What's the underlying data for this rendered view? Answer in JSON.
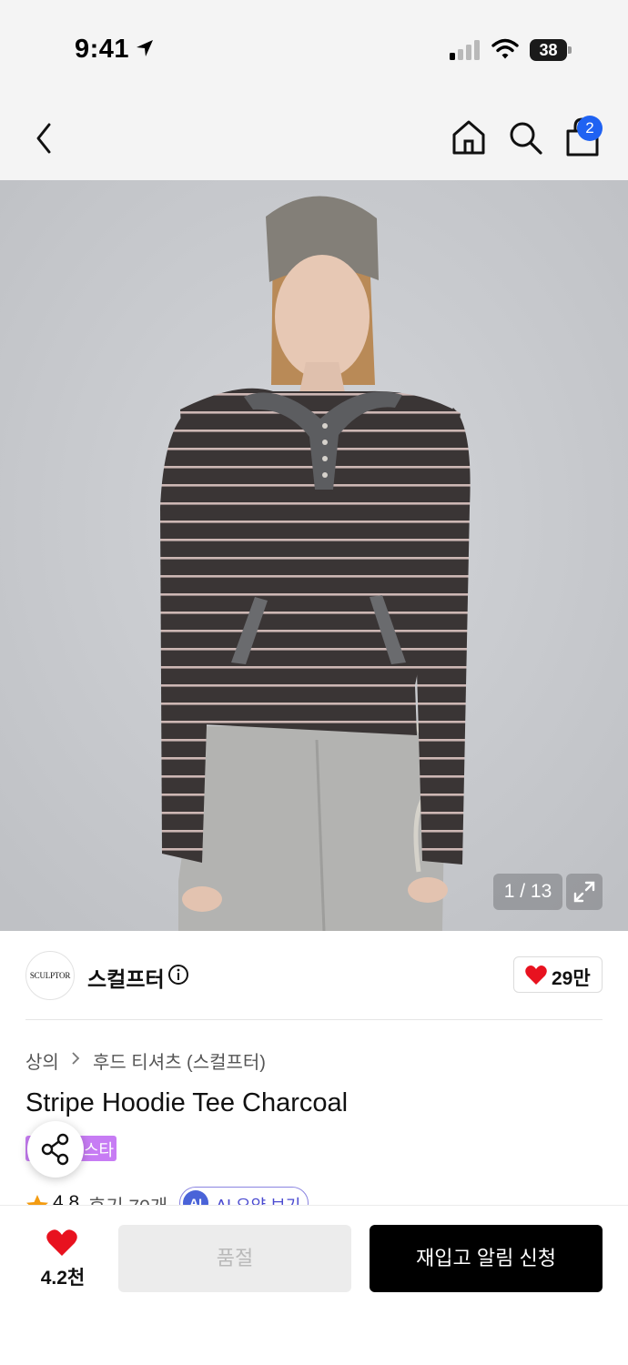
{
  "status_bar": {
    "time": "9:41",
    "battery_level": "38",
    "icons": [
      "location-arrow-icon",
      "signal-icon",
      "wifi-icon",
      "battery-icon"
    ]
  },
  "nav": {
    "icons": [
      "back-icon",
      "home-icon",
      "search-icon",
      "shopping-bag-icon"
    ],
    "cart_badge": "2"
  },
  "gallery": {
    "counter": "1 / 13",
    "icons": [
      "expand-icon"
    ]
  },
  "brand": {
    "logo_text": "SCULPTOR",
    "name": "스컬프터",
    "likes": "29만",
    "icons": [
      "info-icon",
      "heart-icon"
    ]
  },
  "breadcrumb": [
    "상의",
    "후드 티셔츠 (스컬프터)"
  ],
  "product": {
    "title": "Stripe Hoodie Tee Charcoal",
    "tag": "스타",
    "rating": "4.8",
    "reviews": "후기 70개",
    "ai_badge": "AI",
    "ai_summary": "AI 요약 보기"
  },
  "bottom_bar": {
    "favorite_count": "4.2천",
    "soldout_label": "품절",
    "restock_label": "재입고 알림 신청"
  },
  "colors": {
    "cart_badge": "#1f62f2",
    "heart": "#e8121f",
    "tag": "#c77cf4",
    "ai_accent": "#4a63d8",
    "primary_button": "#000000",
    "disabled_button": "#ececec"
  }
}
